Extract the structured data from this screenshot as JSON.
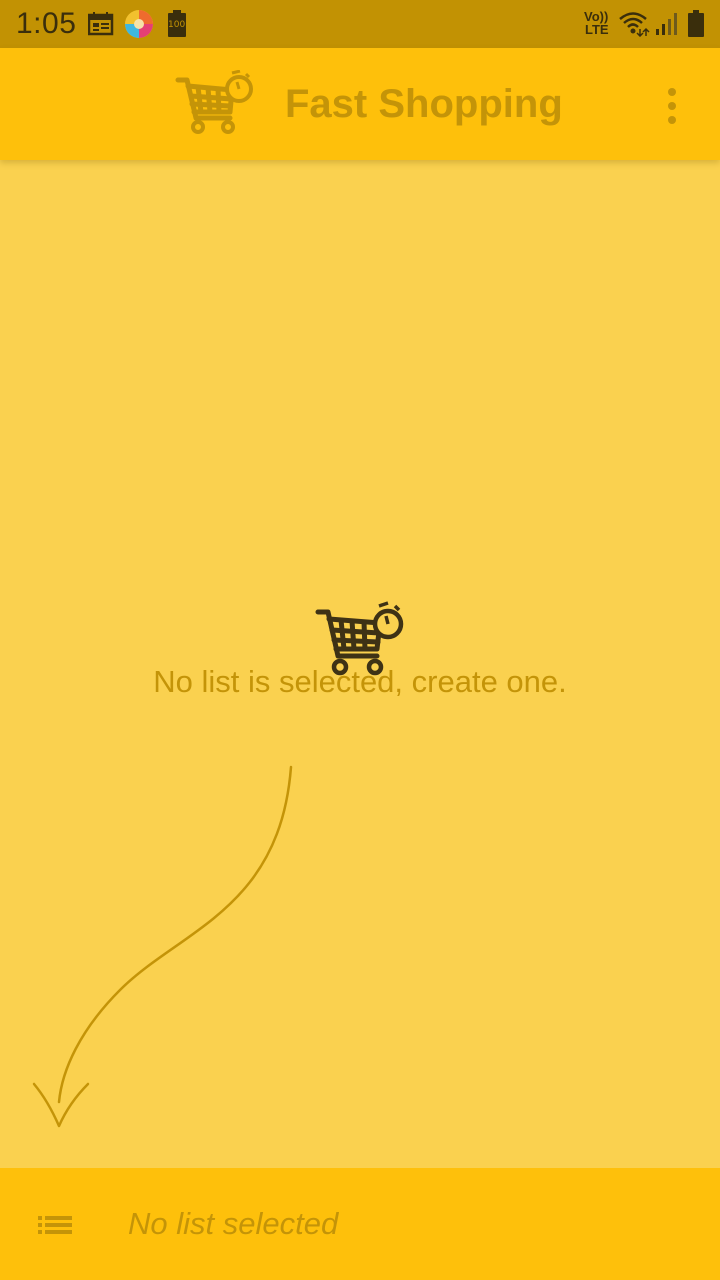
{
  "status_bar": {
    "time": "1:05",
    "battery_level_label": "100",
    "network_label_top": "Vo))",
    "network_label_bottom": "LTE"
  },
  "app_bar": {
    "title": "Fast Shopping",
    "overflow_icon": "more-vert-icon",
    "logo_icon": "cart-stopwatch-icon"
  },
  "empty_state": {
    "message": "No list is selected, create one.",
    "icon": "cart-stopwatch-icon"
  },
  "bottom_bar": {
    "list_icon": "list-icon",
    "label": "No list selected"
  },
  "colors": {
    "status_bar": "#C29203",
    "app_bar": "#FEC00B",
    "background": "#FAD14F",
    "accent_text": "#C49408",
    "dark_icon": "#3A2E0C"
  }
}
